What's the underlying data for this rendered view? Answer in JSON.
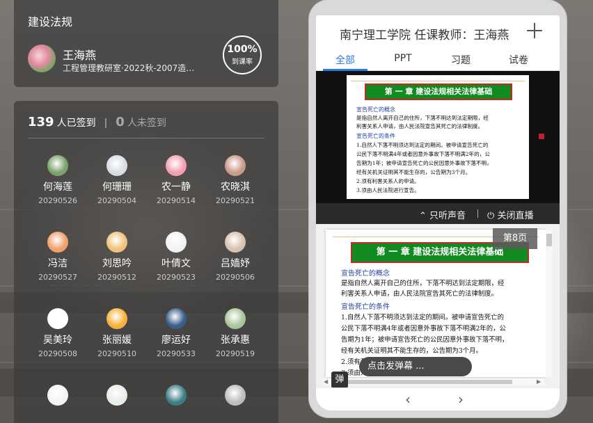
{
  "course": {
    "title": "建设法规",
    "teacher_name": "王海燕",
    "department": "工程管理教研室·2022秋-2007造价...",
    "attendance_rate_value": "100%",
    "attendance_rate_label": "到课率"
  },
  "attendance": {
    "signed_count": "139",
    "signed_label": "人已签到",
    "separator": "|",
    "unsigned_count": "0",
    "unsigned_label": "人未签到",
    "students": [
      {
        "name": "何海莲",
        "id": "20290526",
        "color": "#7aa36a"
      },
      {
        "name": "何珊珊",
        "id": "20290504",
        "color": "#d8dde2"
      },
      {
        "name": "农一静",
        "id": "20290514",
        "color": "#f0a0b0"
      },
      {
        "name": "农晓淇",
        "id": "20290521",
        "color": "#c89a8a"
      },
      {
        "name": "冯洁",
        "id": "20290527",
        "color": "#f0a06a"
      },
      {
        "name": "刘思吟",
        "id": "20290512",
        "color": "#f1c27a"
      },
      {
        "name": "叶倩文",
        "id": "20290523",
        "color": "#f2f2f2"
      },
      {
        "name": "吕嫱妤",
        "id": "20290506",
        "color": "#d7c1b0"
      },
      {
        "name": "吴美玲",
        "id": "20290508",
        "color": "#ffffff"
      },
      {
        "name": "张丽媛",
        "id": "20290510",
        "color": "#f6b13b"
      },
      {
        "name": "廖运好",
        "id": "20290533",
        "color": "#3a5f8a"
      },
      {
        "name": "张承惠",
        "id": "20290519",
        "color": "#a9c59a"
      },
      {
        "name": "",
        "id": "",
        "color": "#f4f4f4"
      },
      {
        "name": "",
        "id": "",
        "color": "#e8ece6"
      },
      {
        "name": "",
        "id": "",
        "color": "#3d7e86"
      },
      {
        "name": "",
        "id": "",
        "color": "#bdbdbd"
      }
    ]
  },
  "phone": {
    "title": "南宁理工学院 任课教师：王海燕",
    "tabs": [
      "全部",
      "PPT",
      "习题",
      "试卷"
    ],
    "active_tab": 0,
    "audio_only": "只听声音",
    "close_live": "关闭直播",
    "page_badge": "第8页",
    "danmu_badge": "弹",
    "danmu_placeholder": "点击发弹幕 ...",
    "nav_prev": "‹",
    "nav_next": "›"
  },
  "slide": {
    "chapter": "第 一 章  建设法规相关法律基础",
    "section1_head": "宣告死亡的概念",
    "section1_lines": [
      "是指自然人离开自己的住所，下落不明达到法定期限，经",
      "利害关系人申请，由人民法院宣告其死亡的法律制度。"
    ],
    "section2_head": "宣告死亡的条件",
    "section2_lines": [
      "1.自然人下落不明须达到法定的期间。被申请宣告死亡的",
      "公民下落不明满4年或者因意外事故下落不明满2年的，公",
      "告期为1年；被申请宣告死亡的公民因意外事故下落不明，",
      "经有关机关证明其不能生存的，公告期为3个月。",
      "2.须有利害关系人的申请。",
      "3.须由人民法院进行宣告。"
    ]
  },
  "colors": {
    "accent": "#2d7be5",
    "slide_banner": "#118a1f",
    "slide_banner_border": "#c62828",
    "slide_heading": "#1b3fa0"
  }
}
